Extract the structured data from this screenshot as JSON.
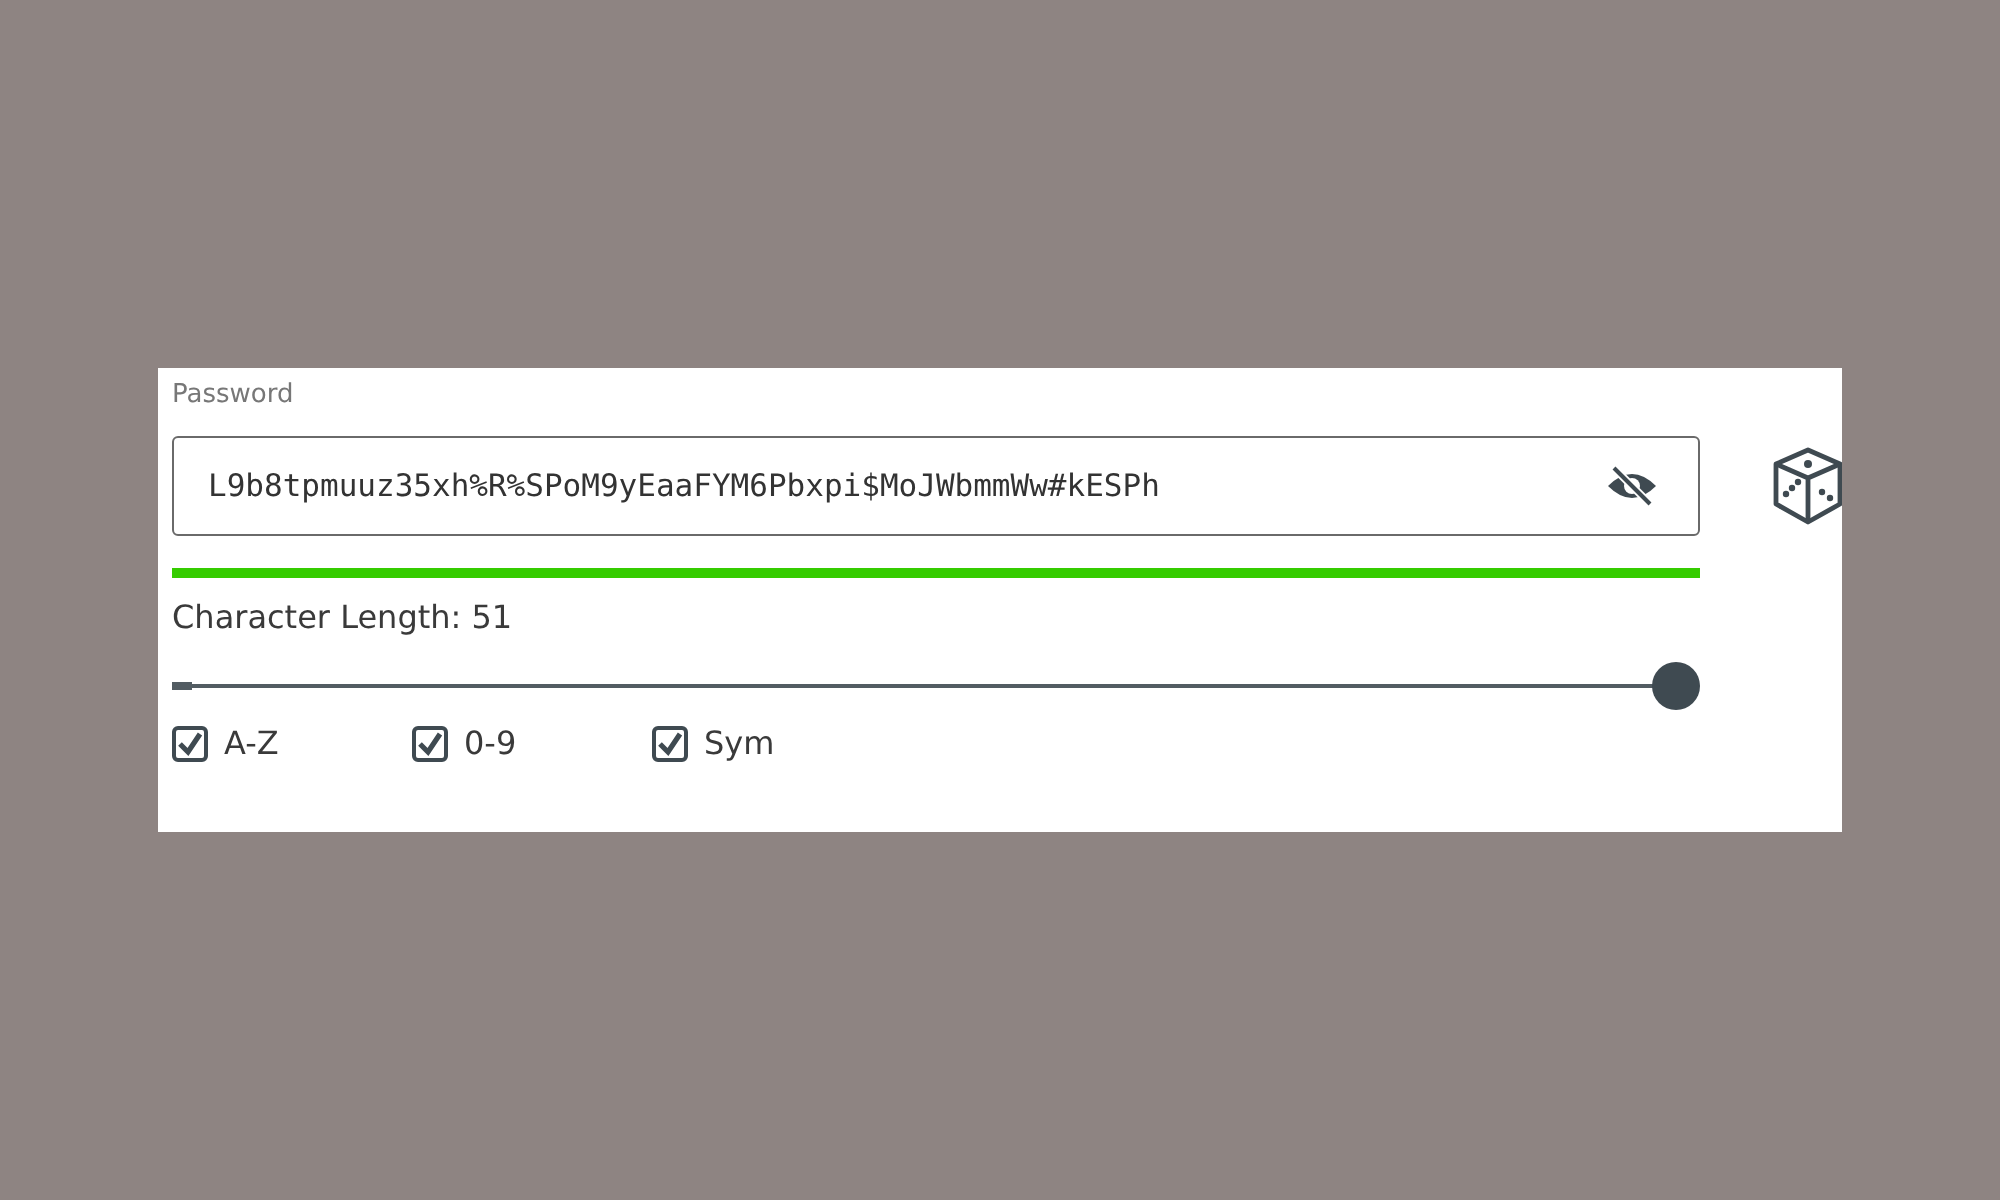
{
  "password_field": {
    "label": "Password",
    "value": "L9b8tpmuuz35xh%R%SPoM9yEaaFYM6Pbxpi$MoJWbmmWw#kESPh",
    "visible": true
  },
  "strength_meter": {
    "level": 1.0
  },
  "length": {
    "label": "Character Length: 51",
    "level": 1.0
  },
  "options": [
    {
      "label": "A-Z",
      "checked": true
    },
    {
      "label": "0-9",
      "checked": true
    },
    {
      "label": "Sym",
      "checked": true
    }
  ]
}
